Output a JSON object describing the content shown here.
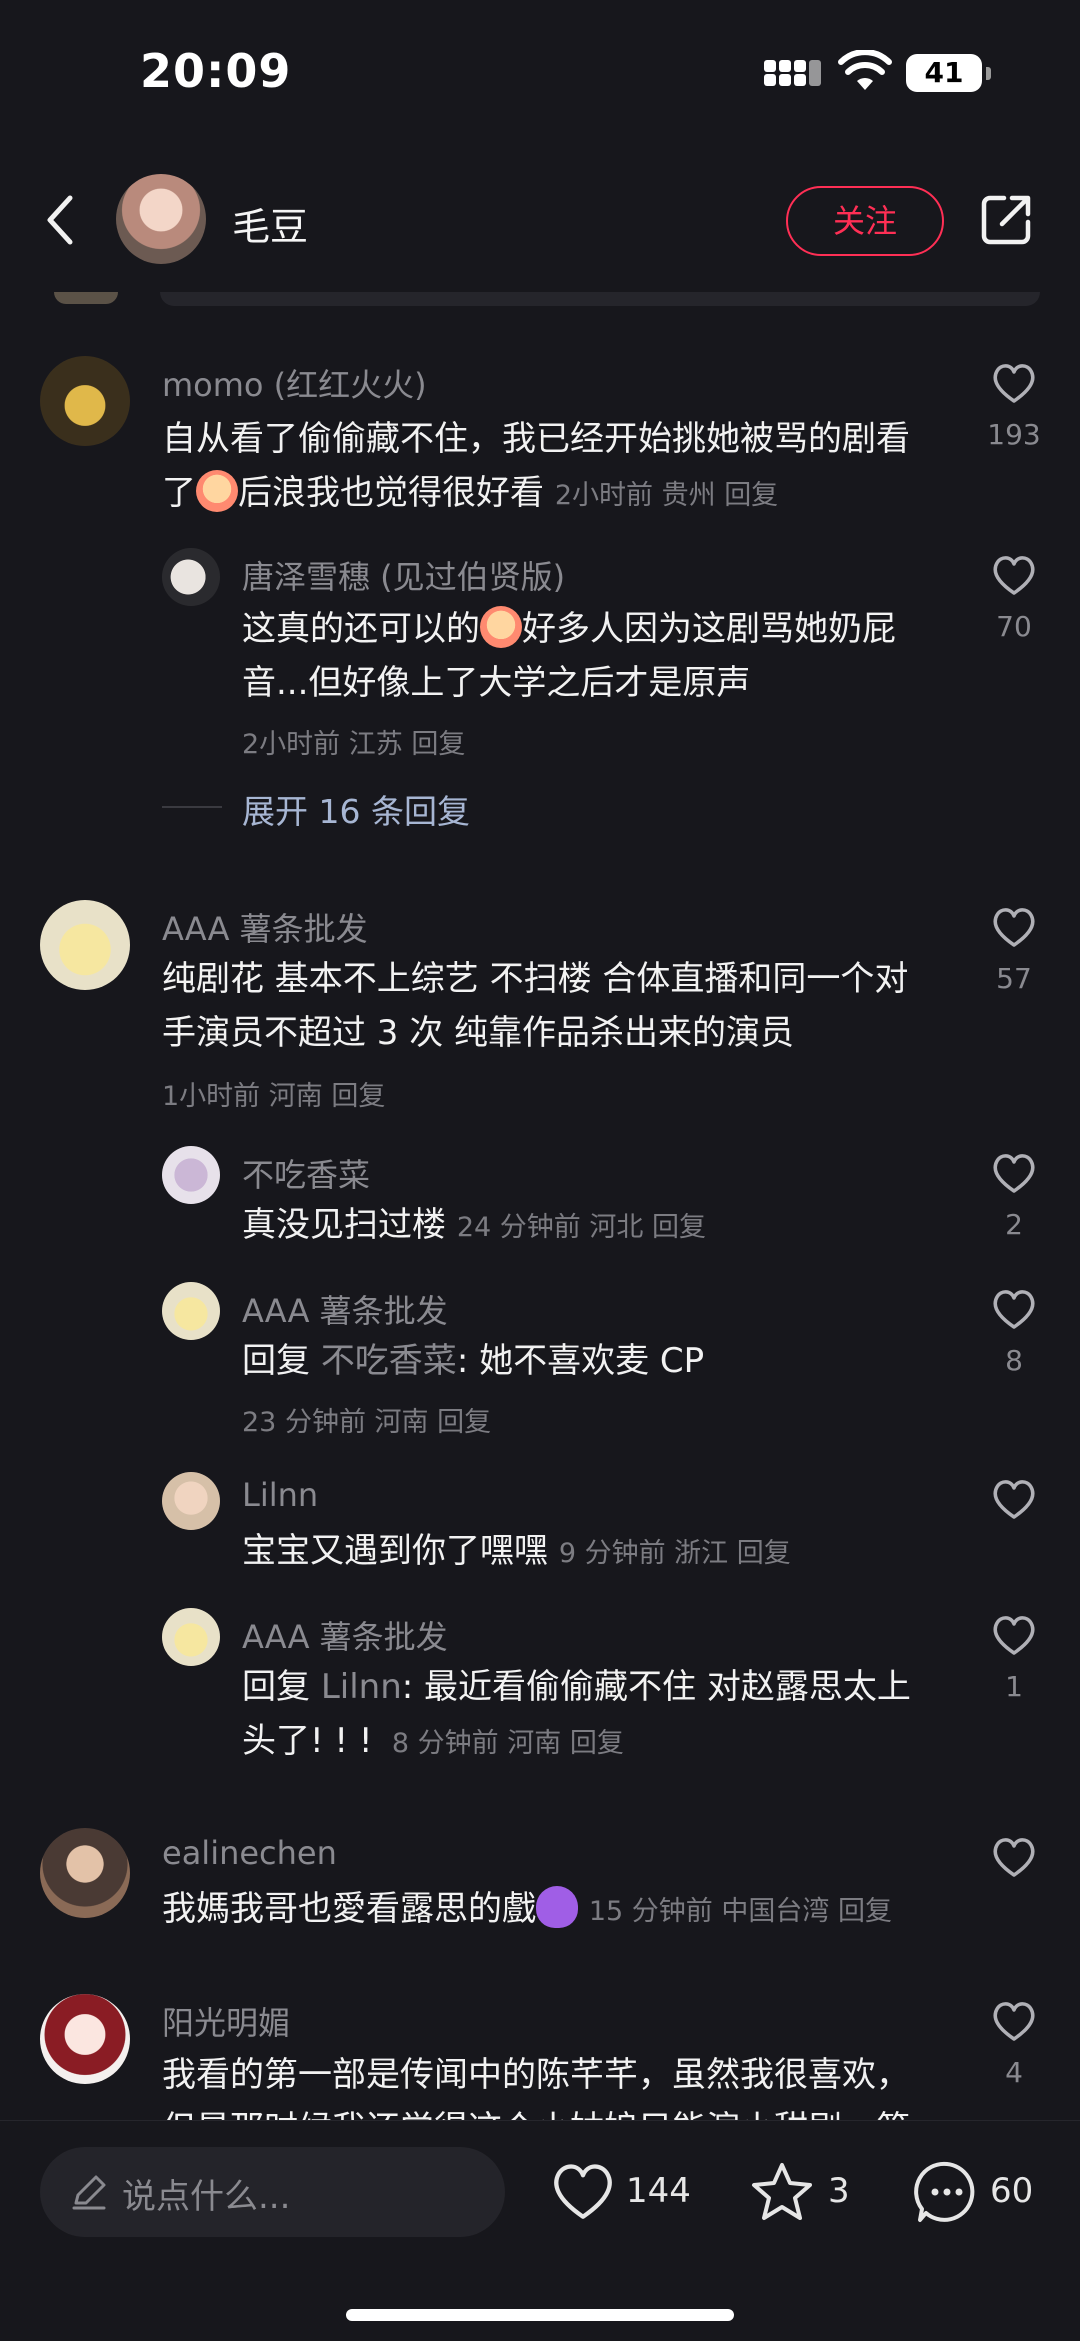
{
  "status_bar": {
    "time": "20:09",
    "battery": "41"
  },
  "header": {
    "username": "毛豆",
    "follow_label": "关注"
  },
  "comments": [
    {
      "username": "momo (红红火火)",
      "text_a": "自从看了偷偷藏不住，我已经开始挑她被骂的剧看",
      "text_b1": "了",
      "text_b2": "后浪我也觉得很好看",
      "time": "2小时前",
      "location": "贵州",
      "reply_label": "回复",
      "likes": "193",
      "replies": [
        {
          "username": "唐泽雪穗 (见过伯贤版)",
          "text_a1": "这真的还可以的",
          "text_a2": "好多人因为这剧骂她奶屁",
          "text_b": "音...但好像上了大学之后才是原声",
          "time": "2小时前",
          "location": "江苏",
          "reply_label": "回复",
          "likes": "70"
        }
      ],
      "expand_label": "展开 16 条回复"
    },
    {
      "username": "AAA 薯条批发",
      "text_a": "纯剧花 基本不上综艺 不扫楼 合体直播和同一个对",
      "text_b": "手演员不超过 3 次 纯靠作品杀出来的演员",
      "time": "1小时前",
      "location": "河南",
      "reply_label": "回复",
      "likes": "57",
      "replies": [
        {
          "username": "不吃香菜",
          "text": "真没见扫过楼",
          "time": "24 分钟前",
          "location": "河北",
          "reply_label": "回复",
          "likes": "2"
        },
        {
          "username": "AAA 薯条批发",
          "reply_prefix": "回复",
          "reply_target": "不吃香菜",
          "text": ": 她不喜欢麦 CP",
          "time": "23 分钟前",
          "location": "河南",
          "reply_label": "回复",
          "likes": "8"
        },
        {
          "username": "Lilnn",
          "text": "宝宝又遇到你了嘿嘿",
          "time": "9 分钟前",
          "location": "浙江",
          "reply_label": "回复",
          "likes": ""
        },
        {
          "username": "AAA 薯条批发",
          "reply_prefix": "回复",
          "reply_target": "Lilnn",
          "text": ": 最近看偷偷藏不住 对赵露思太上",
          "text_b": "头了! ! !",
          "time": "8 分钟前",
          "location": "河南",
          "reply_label": "回复",
          "likes": "1"
        }
      ]
    },
    {
      "username": "ealinechen",
      "text": "我媽我哥也愛看露思的戲",
      "time": "15 分钟前",
      "location": "中国台湾",
      "reply_label": "回复",
      "likes": ""
    },
    {
      "username": "阳光明媚",
      "text_a": "我看的第一部是传闻中的陈芊芊，虽然我很喜欢，",
      "text_b": "但是那时候我还觉得这个小姑娘只能演小甜剧，第",
      "likes": "4"
    }
  ],
  "bottom_bar": {
    "input_placeholder": "说点什么...",
    "like_count": "144",
    "favorite_count": "3",
    "comment_count": "60"
  },
  "icons": {
    "back": "chevron-left-icon",
    "share": "share-icon",
    "like": "heart-icon",
    "favorite": "star-icon",
    "comment": "chat-bubble-icon",
    "edit": "pencil-icon"
  },
  "colors": {
    "background": "#17171c",
    "accent": "#ff2f55",
    "muted_text": "#8a8a90",
    "link": "#a7b6d3"
  }
}
